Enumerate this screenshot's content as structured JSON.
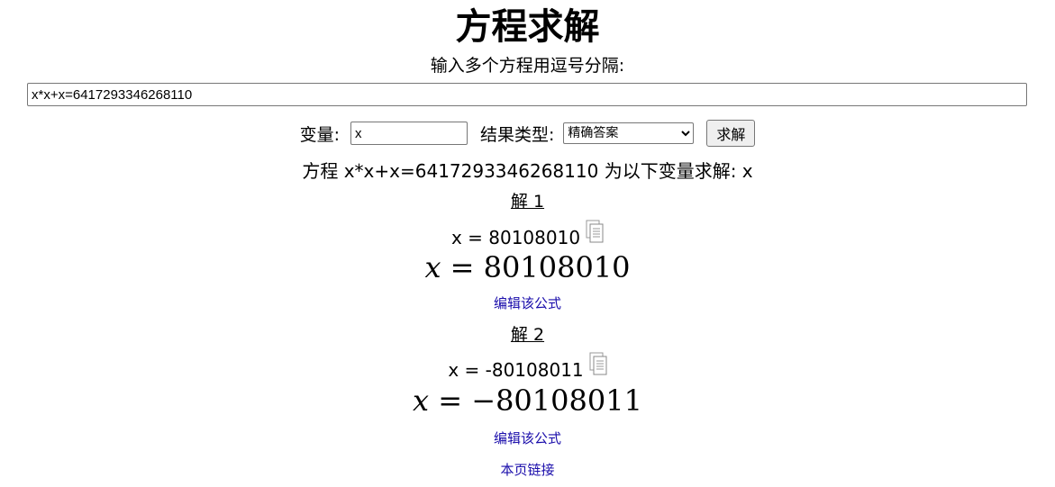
{
  "title": "方程求解",
  "prompt": "输入多个方程用逗号分隔:",
  "equation_input": {
    "value": "x*x+x=6417293346268110"
  },
  "controls": {
    "variable_label": "变量:",
    "variable_value": "x",
    "result_type_label": "结果类型:",
    "result_type_selected": "精确答案",
    "solve_button": "求解"
  },
  "summary": "方程 x*x+x=6417293346268110 为以下变量求解: x",
  "solutions": [
    {
      "heading": "解 1",
      "text": "x = 80108010",
      "math_var": "x",
      "math_eq": "=",
      "math_value": "80108010",
      "edit_link": "编辑该公式"
    },
    {
      "heading": "解 2",
      "text": "x = -80108011",
      "math_var": "x",
      "math_eq": "=",
      "math_value": "−80108011",
      "edit_link": "编辑该公式"
    }
  ],
  "page_link": "本页链接",
  "icons": [
    "copy-icon"
  ]
}
